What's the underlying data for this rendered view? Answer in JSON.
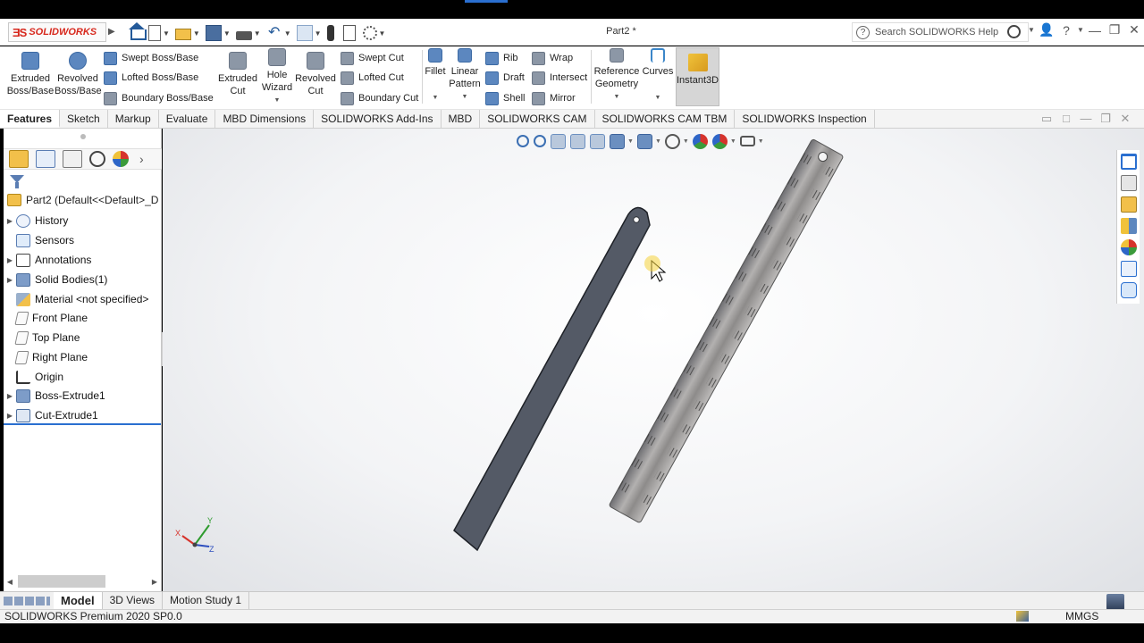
{
  "app": {
    "logo_mark": "ƎS",
    "logo_text": "SOLIDWORKS",
    "document_title": "Part2 *",
    "help_search_placeholder": "Search SOLIDWORKS Help",
    "help_q": "?",
    "help_menu_q": "?",
    "win_minimize": "—",
    "win_restore": "❐",
    "win_close": "✕"
  },
  "ribbon": {
    "extruded_boss": "Extruded Boss/Base",
    "revolved_boss": "Revolved Boss/Base",
    "swept_boss": "Swept Boss/Base",
    "lofted_boss": "Lofted Boss/Base",
    "boundary_boss": "Boundary Boss/Base",
    "extruded_cut": "Extruded Cut",
    "hole_wizard": "Hole Wizard",
    "revolved_cut": "Revolved Cut",
    "swept_cut": "Swept Cut",
    "lofted_cut": "Lofted Cut",
    "boundary_cut": "Boundary Cut",
    "fillet": "Fillet",
    "linear_pattern": "Linear Pattern",
    "rib": "Rib",
    "draft": "Draft",
    "shell": "Shell",
    "wrap": "Wrap",
    "intersect": "Intersect",
    "mirror": "Mirror",
    "reference_geometry": "Reference Geometry",
    "curves": "Curves",
    "instant3d": "Instant3D"
  },
  "tabs": [
    {
      "label": "Features",
      "active": true
    },
    {
      "label": "Sketch"
    },
    {
      "label": "Markup"
    },
    {
      "label": "Evaluate"
    },
    {
      "label": "MBD Dimensions"
    },
    {
      "label": "SOLIDWORKS Add-Ins"
    },
    {
      "label": "MBD"
    },
    {
      "label": "SOLIDWORKS CAM"
    },
    {
      "label": "SOLIDWORKS CAM TBM"
    },
    {
      "label": "SOLIDWORKS Inspection"
    }
  ],
  "tree": {
    "root": "Part2  (Default<<Default>_D",
    "items": [
      {
        "label": "History",
        "expandable": true
      },
      {
        "label": "Sensors",
        "expandable": false
      },
      {
        "label": "Annotations",
        "expandable": true
      },
      {
        "label": "Solid Bodies(1)",
        "expandable": true
      },
      {
        "label": "Material <not specified>",
        "expandable": false
      },
      {
        "label": "Front Plane",
        "expandable": false
      },
      {
        "label": "Top Plane",
        "expandable": false
      },
      {
        "label": "Right Plane",
        "expandable": false
      },
      {
        "label": "Origin",
        "expandable": false
      },
      {
        "label": "Boss-Extrude1",
        "expandable": true
      },
      {
        "label": "Cut-Extrude1",
        "expandable": true
      }
    ]
  },
  "bottom_tabs": [
    {
      "label": "Model",
      "active": true
    },
    {
      "label": "3D Views"
    },
    {
      "label": "Motion Study 1"
    }
  ],
  "status": {
    "product": "SOLIDWORKS Premium 2020 SP0.0",
    "units": "MMGS"
  },
  "colors": {
    "part_face": "#545a66",
    "selection_blue": "#2a6fd0",
    "brand_red": "#d7281d"
  },
  "triad": {
    "x": "X",
    "y": "Y",
    "z": "Z"
  }
}
